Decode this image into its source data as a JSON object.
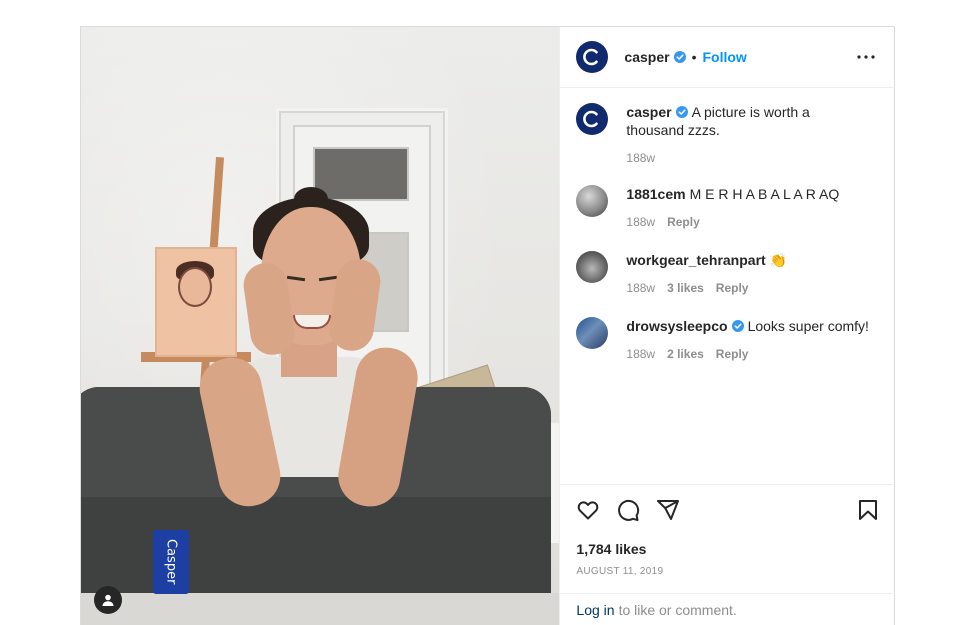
{
  "post": {
    "author": "casper",
    "follow_label": "Follow",
    "separator": "•",
    "photo_label_text": "Casper"
  },
  "caption": {
    "user": "casper",
    "text": "A picture is worth a thousand zzzs.",
    "time": "188w"
  },
  "comments": [
    {
      "user": "1881cem",
      "text": "M E R H A B A L A R AQ",
      "time": "188w",
      "likes": "",
      "reply": "Reply",
      "verified": false
    },
    {
      "user": "workgear_tehranpart",
      "text": "👏",
      "time": "188w",
      "likes": "3 likes",
      "reply": "Reply",
      "verified": false
    },
    {
      "user": "drowsysleepco",
      "text": "Looks super comfy!",
      "time": "188w",
      "likes": "2 likes",
      "reply": "Reply",
      "verified": true
    }
  ],
  "stats": {
    "likes": "1,784 likes",
    "date": "August 11, 2019"
  },
  "login_bar": {
    "link": "Log in",
    "text": "to like or comment."
  },
  "colors": {
    "accent": "#0095f6",
    "verified": "#3897f0",
    "brand": "#112a6e",
    "muted": "#8e8e8e"
  },
  "icons": [
    "like-icon",
    "comment-icon",
    "share-icon",
    "save-icon",
    "more-options-icon",
    "verified-badge-icon",
    "user-tag-icon"
  ]
}
